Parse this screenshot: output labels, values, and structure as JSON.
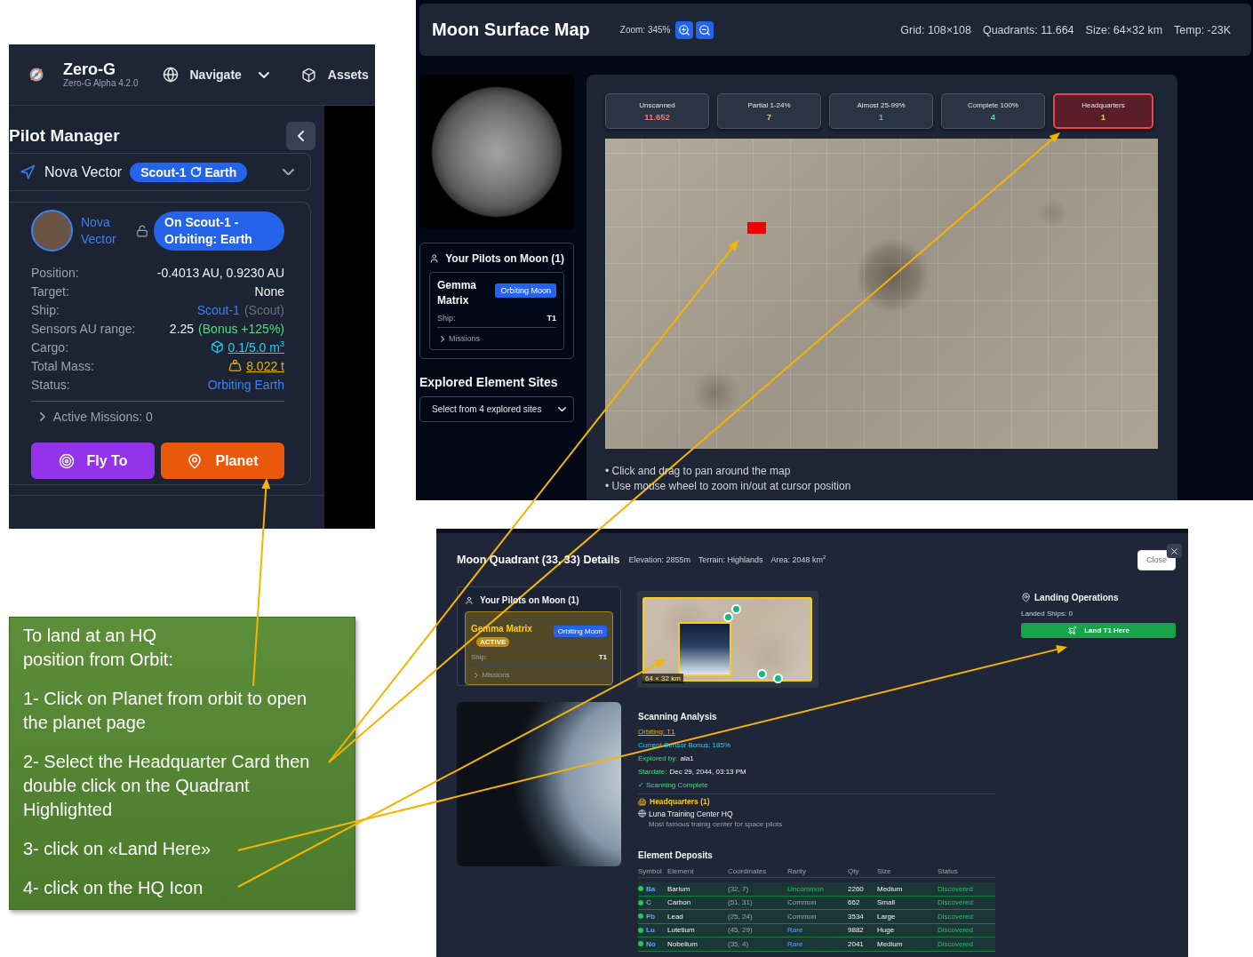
{
  "pilot_manager": {
    "app_name": "Zero-G",
    "app_version": "Zero-G Alpha 4.2.0",
    "nav": [
      {
        "label": "Navigate",
        "kind": "menu"
      },
      {
        "label": "Assets",
        "kind": "link"
      }
    ],
    "title": "Pilot Manager",
    "selector": {
      "pilot": "Nova Vector",
      "ship": "Scout-1",
      "location": "Earth"
    },
    "pilot": {
      "name": "Nova Vector",
      "status": "On Scout-1 - Orbiting: Earth"
    },
    "stats": [
      {
        "label": "Position:",
        "value": "-0.4013 AU, 0.9230 AU",
        "kind": "plain"
      },
      {
        "label": "Target:",
        "value": "None",
        "kind": "plain"
      },
      {
        "label": "Ship:",
        "value": "Scout-1",
        "note": "(Scout)",
        "kind": "ship"
      },
      {
        "label": "Sensors AU range:",
        "value": "2.25",
        "note": "(Bonus +125%)",
        "kind": "bonus"
      },
      {
        "label": "Cargo:",
        "value": "0.1/5.0 m$^{3}$",
        "kind": "cargo"
      },
      {
        "label": "Total Mass:",
        "value": "8.022 t",
        "kind": "mass"
      },
      {
        "label": "Status:",
        "value": "Orbiting Earth",
        "kind": "status"
      }
    ],
    "missions": "Active Missions: 0",
    "actions": [
      {
        "label": "Fly To",
        "kind": "fly"
      },
      {
        "label": "Planet",
        "kind": "planet"
      }
    ]
  },
  "moon_map": {
    "title": "Moon Surface Map",
    "zoom": "Zoom: 345%",
    "stats": [
      "Grid: 108×108",
      "Quadrants: 11.664",
      "Size: 64×32 km",
      "Temp: -23K"
    ],
    "pilots": {
      "title": "Your Pilots on Moon (1)",
      "items": [
        {
          "name": "Gemma Matrix",
          "status": "Orbiting Moon",
          "ship_label": "Ship:",
          "ship": "T1",
          "missions": "Missions",
          "selected": false
        }
      ]
    },
    "sites": {
      "title": "Explored Element Sites",
      "value": "Select from 4 explored sites"
    },
    "legend": [
      {
        "label": "Unscanned",
        "count": "11.652",
        "color": "#f87171",
        "selected": false
      },
      {
        "label": "Partial 1-24%",
        "count": "7",
        "color": "#facc15",
        "selected": false
      },
      {
        "label": "Almost 25-99%",
        "count": "1",
        "color": "#60a5fa",
        "selected": false
      },
      {
        "label": "Complete 100%",
        "count": "4",
        "color": "#4ade80",
        "selected": false
      },
      {
        "label": "Headquarters",
        "count": "1",
        "color": "#facc15",
        "selected": true
      }
    ],
    "tips": [
      "• Click and drag to pan around the map",
      "• Use mouse wheel to zoom in/out at cursor position"
    ]
  },
  "quadrant_details": {
    "title": "Moon Quadrant (33, 33) Details",
    "meta": [
      "Elevation: 2855m",
      "Terrain: Highlands",
      "Area: 2048 km$^{2}$"
    ],
    "close": "Close",
    "pilots": {
      "title": "Your Pilots on Moon (1)",
      "items": [
        {
          "name": "Gemma Matrix",
          "badge": "ACTIVE",
          "status": "Orbiting Moon",
          "ship_label": "Ship:",
          "ship": "T1",
          "missions": "Missions",
          "selected": true
        }
      ]
    },
    "preview": {
      "scale": "64 × 32 km"
    },
    "landing": {
      "title": "Landing Operations",
      "landed": "Landed Ships: 0",
      "action": "Land T1 Here"
    },
    "scan": {
      "title": "Scanning Analysis",
      "lines": [
        {
          "kind": "link",
          "text": "Orbiting: T1"
        },
        {
          "kind": "bonus",
          "text": "Current Sensor Bonus: 185%"
        },
        {
          "kind": "field",
          "label": "Explored by:",
          "value": "ala1"
        },
        {
          "kind": "field",
          "label": "Stardate:",
          "value": "Dec 29, 2044, 03:13 PM"
        },
        {
          "kind": "complete",
          "text": "✓ Scanning Complete"
        }
      ]
    },
    "headquarters": {
      "title": "Headquarters (1)",
      "items": [
        {
          "name": "Luna Training Center HQ",
          "description": "Most famous trainig center for space pilots"
        }
      ]
    },
    "deposits": {
      "title": "Element Deposits",
      "columns": [
        "Symbol",
        "Element",
        "Coordinates",
        "Rarity",
        "Qty",
        "Size",
        "Status"
      ],
      "rows": [
        {
          "symbol": "Ba",
          "element": "Barium",
          "coordinates": "(32, 7)",
          "rarity": "Uncommon",
          "kind": "uncommon",
          "qty": "2260",
          "size": "Medium",
          "status": "Discovered"
        },
        {
          "symbol": "C",
          "element": "Carbon",
          "coordinates": "(51, 31)",
          "rarity": "Common",
          "kind": "common",
          "qty": "662",
          "size": "Small",
          "status": "Discovered"
        },
        {
          "symbol": "Pb",
          "element": "Lead",
          "coordinates": "(25, 24)",
          "rarity": "Common",
          "kind": "common",
          "qty": "3534",
          "size": "Large",
          "status": "Discovered"
        },
        {
          "symbol": "Lu",
          "element": "Lutetium",
          "coordinates": "(45, 29)",
          "rarity": "Rare",
          "kind": "rare",
          "qty": "9882",
          "size": "Huge",
          "status": "Discovered"
        },
        {
          "symbol": "No",
          "element": "Nobelium",
          "coordinates": "(35, 4)",
          "rarity": "Rare",
          "kind": "rare",
          "qty": "2041",
          "size": "Medium",
          "status": "Discovered"
        }
      ]
    }
  },
  "instructions": {
    "heading": "To land at an HQ position from Orbit:",
    "steps": [
      "1- Click on Planet from orbit to open the planet page",
      "2- Select the Headquarter Card then double click on the Quadrant Highlighted",
      "3- click on «Land Here»",
      "4- click on the HQ Icon"
    ]
  }
}
